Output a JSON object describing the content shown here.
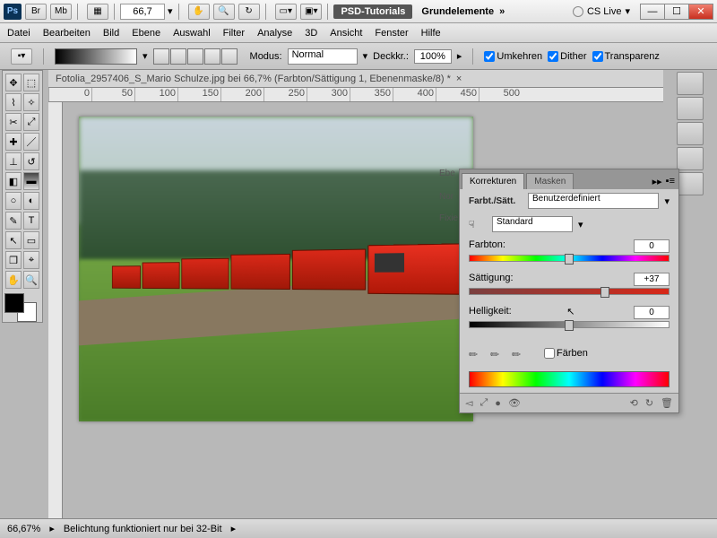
{
  "titlebar": {
    "ps": "Ps",
    "br": "Br",
    "mb": "Mb",
    "zoom": "66,7",
    "psd_tut": "PSD-Tutorials",
    "grund": "Grundelemente",
    "cslive": "CS Live"
  },
  "menu": [
    "Datei",
    "Bearbeiten",
    "Bild",
    "Ebene",
    "Auswahl",
    "Filter",
    "Analyse",
    "3D",
    "Ansicht",
    "Fenster",
    "Hilfe"
  ],
  "options": {
    "modus_lbl": "Modus:",
    "modus_val": "Normal",
    "deck_lbl": "Deckkr.:",
    "deck_val": "100%",
    "umkehren": "Umkehren",
    "dither": "Dither",
    "transparenz": "Transparenz"
  },
  "doc": {
    "tab": "Fotolia_2957406_S_Mario Schulze.jpg bei 66,7%  (Farbton/Sättigung 1, Ebenenmaske/8) *",
    "ruler_marks": [
      "0",
      "50",
      "100",
      "150",
      "200",
      "250",
      "300",
      "350",
      "400",
      "450",
      "500"
    ]
  },
  "panel": {
    "tab_left_hidden": "Ebe",
    "tab_korr": "Korrekturen",
    "tab_mask": "Masken",
    "title": "Farbt./Sätt.",
    "preset": "Benutzerdefiniert",
    "range": "Standard",
    "hue_lbl": "Farbton:",
    "hue_val": "0",
    "sat_lbl": "Sättigung:",
    "sat_val": "+37",
    "light_lbl": "Helligkeit:",
    "light_val": "0",
    "colorize": "Färben",
    "row_hidden_nor": "Nor",
    "row_hidden_fix": "Fixie"
  },
  "status": {
    "zoom": "66,67%",
    "msg": "Belichtung funktioniert nur bei 32-Bit"
  }
}
